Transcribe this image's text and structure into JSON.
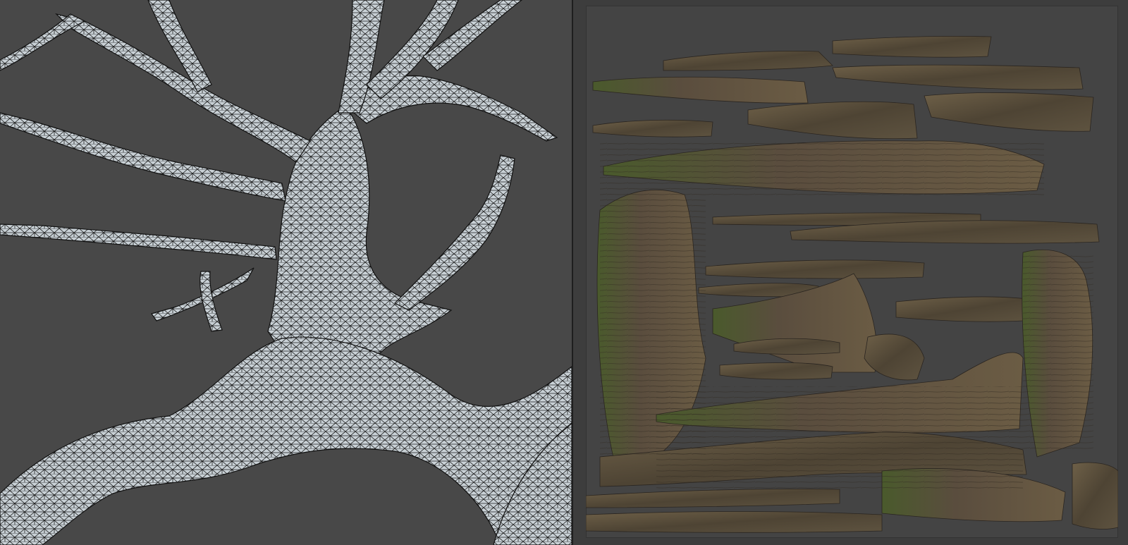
{
  "viewport_3d": {
    "view": "wireframe-on-shaded",
    "background_color": "#484848",
    "mesh_color": "#c9d1d6",
    "wire_color": "#1a1a1a"
  },
  "uv_editor": {
    "background_color": "#3d3d3d",
    "canvas_color": "#444444",
    "texture": "tree-bark-atlas",
    "bark_colors": [
      "#5a4d3e",
      "#6e6048",
      "#4a5a2c",
      "#3c3428"
    ]
  },
  "colors": {
    "divider": "#1e1e1e"
  }
}
